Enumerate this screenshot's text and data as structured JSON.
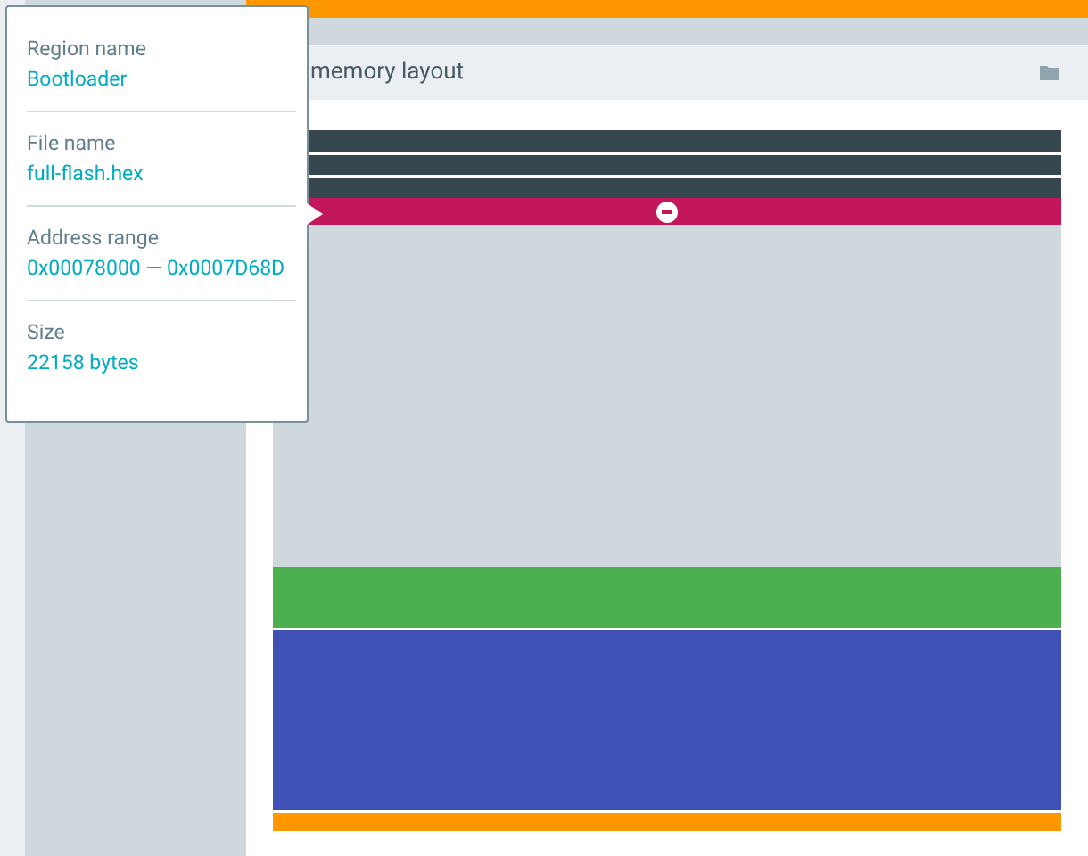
{
  "header": {
    "title": "memory layout"
  },
  "regions": [
    {
      "color": "#37474f",
      "selected": false
    },
    {
      "color": "#37474f",
      "selected": false
    },
    {
      "color": "#37474f",
      "selected": false
    },
    {
      "color": "#c2185b",
      "selected": true
    },
    {
      "color": "#cfd8dc",
      "selected": false
    },
    {
      "color": "#4caf50",
      "selected": false
    },
    {
      "color": "#3f51b5",
      "selected": false
    },
    {
      "color": "#ff9800",
      "selected": false
    }
  ],
  "tooltip": {
    "fields": [
      {
        "label": "Region name",
        "value": "Bootloader"
      },
      {
        "label": "File name",
        "value": "full-flash.hex"
      },
      {
        "label": "Address range",
        "value": "0x00078000 — 0x0007D68D"
      },
      {
        "label": "Size",
        "value": "22158 bytes"
      }
    ]
  }
}
